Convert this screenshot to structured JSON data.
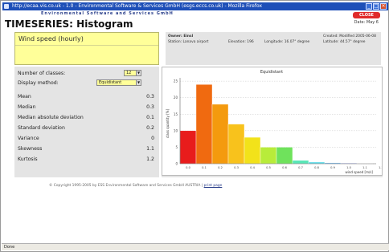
{
  "window": {
    "title": "http://ecaa.vis.co.uk - 1.0 - Environmental Software & Services GmbH (esgs.eccs.co.uk) - Mozilla Firefox",
    "brand": "Environmental Software and Services GmbH"
  },
  "header": {
    "close_label": "CLOSE",
    "date": "Date: May 6"
  },
  "page": {
    "title": "TIMESERIES: Histogram"
  },
  "variable": {
    "name": "Wind speed (hourly)"
  },
  "meta": {
    "owner_label": "Owner: Einsl",
    "station": "Station: Lanava airport",
    "elevation": "Elevation: 196",
    "longitude": "Longitude: 16.07° degree",
    "latitude": "Latitude: 44.57° degree",
    "created": "Created: Modified 2005-06-08"
  },
  "controls": {
    "classes_label": "Number of classes:",
    "classes_value": "12",
    "display_label": "Display method:",
    "display_value": "Equidistant"
  },
  "stats": [
    {
      "label": "Mean",
      "value": "0.3"
    },
    {
      "label": "Median",
      "value": "0.3"
    },
    {
      "label": "Median absolute deviation",
      "value": "0.1"
    },
    {
      "label": "Standard deviation",
      "value": "0.2"
    },
    {
      "label": "Variance",
      "value": "0"
    },
    {
      "label": "Skewness",
      "value": "1.1"
    },
    {
      "label": "Kurtosis",
      "value": "1.2"
    }
  ],
  "footer": {
    "copyright": "© Copyright 1995-2005 by  ESS  Environmental Software and Services GmbH AUSTRIA |",
    "print_link": "print page"
  },
  "status": {
    "text": "Done"
  },
  "chart_data": {
    "type": "bar",
    "title": "Equidistant",
    "xlabel": "wind speed [m/s]",
    "ylabel": "class quantity [%]",
    "categories": [
      "0.0",
      "0.1",
      "0.2",
      "0.3",
      "0.4",
      "0.5",
      "0.6",
      "0.7",
      "0.8",
      "0.9",
      "1.0",
      "1.1"
    ],
    "x_ticks": [
      "0.0",
      "0.1",
      "0.2",
      "0.3",
      "0.4",
      "0.5",
      "0.6",
      "0.7",
      "0.8",
      "0.9",
      "1.0",
      "1.1",
      "1.2"
    ],
    "values": [
      10,
      24,
      18,
      12,
      8,
      5,
      5,
      1,
      0.5,
      0.3,
      0.2,
      0.1
    ],
    "y_ticks": [
      0,
      5,
      10,
      15,
      20,
      25
    ],
    "ylim": [
      0,
      26
    ],
    "grid": true,
    "colors": [
      "#e81c1c",
      "#f06a10",
      "#f49a0e",
      "#f8c21c",
      "#f2e21a",
      "#b8ec3a",
      "#6fe25c",
      "#58e6b6",
      "#58d8e6",
      "#76b8ec",
      "#7a8ee6",
      "#8a72d8"
    ]
  }
}
